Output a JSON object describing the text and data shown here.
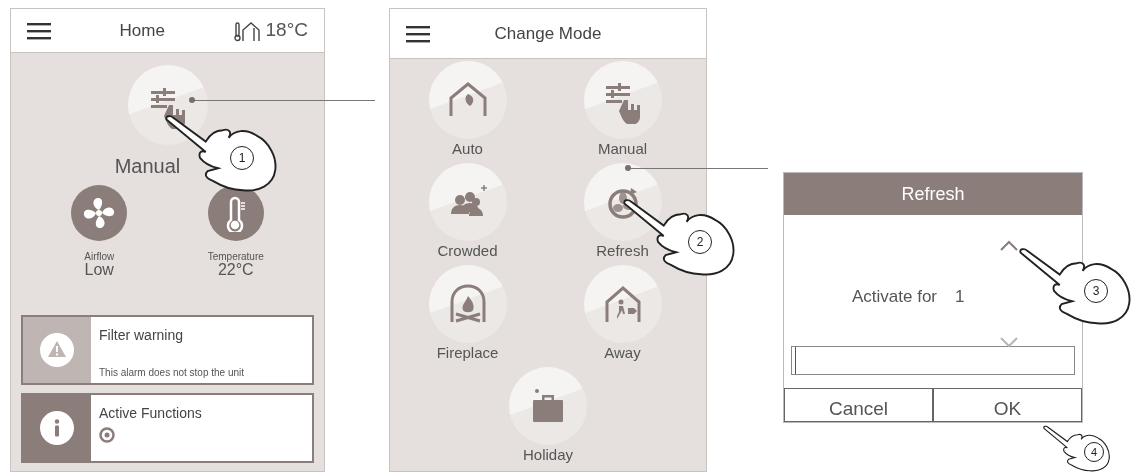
{
  "home": {
    "title": "Home",
    "outdoor_temperature": "18°C",
    "current_mode": {
      "label": "Manual",
      "kind": "manual"
    },
    "readings": [
      {
        "kind": "airflow",
        "label": "Airflow",
        "value": "Low"
      },
      {
        "kind": "temperature",
        "label": "Temperature",
        "value": "22°C"
      }
    ],
    "alerts": [
      {
        "kind": "warning",
        "title": "Filter warning",
        "detail": "This alarm does not stop the unit"
      },
      {
        "kind": "info",
        "title": "Active Functions"
      }
    ]
  },
  "change_mode": {
    "title": "Change Mode",
    "modes": [
      {
        "label": "Auto",
        "kind": "auto"
      },
      {
        "label": "Manual",
        "kind": "manual"
      },
      {
        "label": "Crowded",
        "kind": "crowded"
      },
      {
        "label": "Refresh",
        "kind": "refresh"
      },
      {
        "label": "Fireplace",
        "kind": "fireplace"
      },
      {
        "label": "Away",
        "kind": "away"
      },
      {
        "label": "Holiday",
        "kind": "holiday"
      }
    ]
  },
  "refresh_dialog": {
    "title": "Refresh",
    "label": "Activate for",
    "value": "1",
    "progress": {
      "level": 0.01
    },
    "buttons": [
      "Cancel",
      "OK"
    ]
  },
  "callouts": [
    "1",
    "2",
    "3",
    "4"
  ]
}
